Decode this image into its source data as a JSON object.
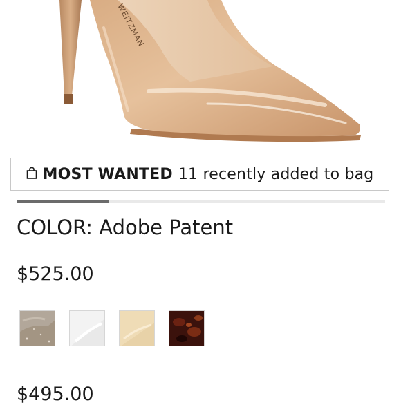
{
  "hero": {
    "image_name": "nude patent pointed-toe pump",
    "brand_stamp": "WEITZMAN"
  },
  "promo": {
    "icon": "shopping-bag-icon",
    "headline": "MOST WANTED",
    "message": "11 recently added to bag"
  },
  "carousel": {
    "progress_fraction": 0.25
  },
  "color": {
    "label": "COLOR:",
    "value": "Adobe Patent"
  },
  "prices": {
    "primary": "$525.00",
    "secondary": "$495.00"
  },
  "swatches": [
    {
      "name": "taupe-glitter",
      "color": "#b2a79a"
    },
    {
      "name": "white",
      "color": "#f3f3f3"
    },
    {
      "name": "cream",
      "color": "#efdcb6"
    },
    {
      "name": "tortoise",
      "color": "#3b120c"
    }
  ]
}
